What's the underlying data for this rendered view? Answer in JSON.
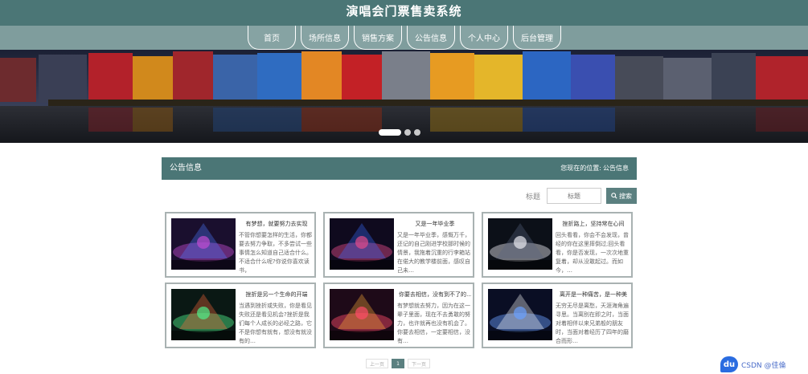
{
  "header": {
    "title": "演唱会门票售卖系统"
  },
  "nav": {
    "items": [
      {
        "label": "首页",
        "name": "nav-item-home"
      },
      {
        "label": "场所信息",
        "name": "nav-item-venue"
      },
      {
        "label": "销售方案",
        "name": "nav-item-sales"
      },
      {
        "label": "公告信息",
        "name": "nav-item-notice"
      },
      {
        "label": "个人中心",
        "name": "nav-item-profile"
      },
      {
        "label": "后台管理",
        "name": "nav-item-admin"
      }
    ]
  },
  "banner": {
    "slide_count": 3,
    "active_slide": 1
  },
  "section": {
    "title": "公告信息",
    "crumb_prefix": "您现在的位置:",
    "crumb_current": "公告信息"
  },
  "search": {
    "label": "标题",
    "placeholder": "标题",
    "button": "搜索"
  },
  "cards": [
    {
      "title": "有梦想，就要努力去实现",
      "body": "不管你想要怎样的生活，你都要去努力争取，不多尝试一些事情怎么知道自己适合什么。不适合什么呢?你说你喜欢读书，"
    },
    {
      "title": "又是一年毕业季",
      "body": "又是一年毕业季，感慨万千，还记的自己刚进学校那时候的情景，我拖着沉重的行李箱站在偌大的教学楼前面，感叹自己未…"
    },
    {
      "title": "挫折路上，坚持常在心间",
      "body": "回头看看，你会不会发现，曾经的你在这里摔倒过;回头看看，你是否发现，一次次地重复着，却从没敢起过。而如今，…"
    },
    {
      "title": "挫折是另一个生命的开端",
      "body": "当遇到挫折或失败，你是看见失败还是看见机会?挫折是我们每个人成长的必经之路，它不是你想有就有，想没有就没有的…"
    },
    {
      "title": "你要去相信，没有到不了的…",
      "body": "有梦想就去努力，因为在这一辈子里面，现在不去勇敢的努力，也许就再也没有机会了。你要去相信，一定要相信，没有…"
    },
    {
      "title": "离开是一种痛苦，是一种美",
      "body": "无穷无尽是离愁，天涯海角遍寻思。当离别在即之时，当面对着相伴以来兄弟般的朋友时，当面对着经历了四年的磨合而形…"
    }
  ],
  "pager": {
    "prev": "上一页",
    "current": "1",
    "next": "下一页"
  },
  "watermark": {
    "logo": "du",
    "text": "CSDN @佳倫"
  }
}
